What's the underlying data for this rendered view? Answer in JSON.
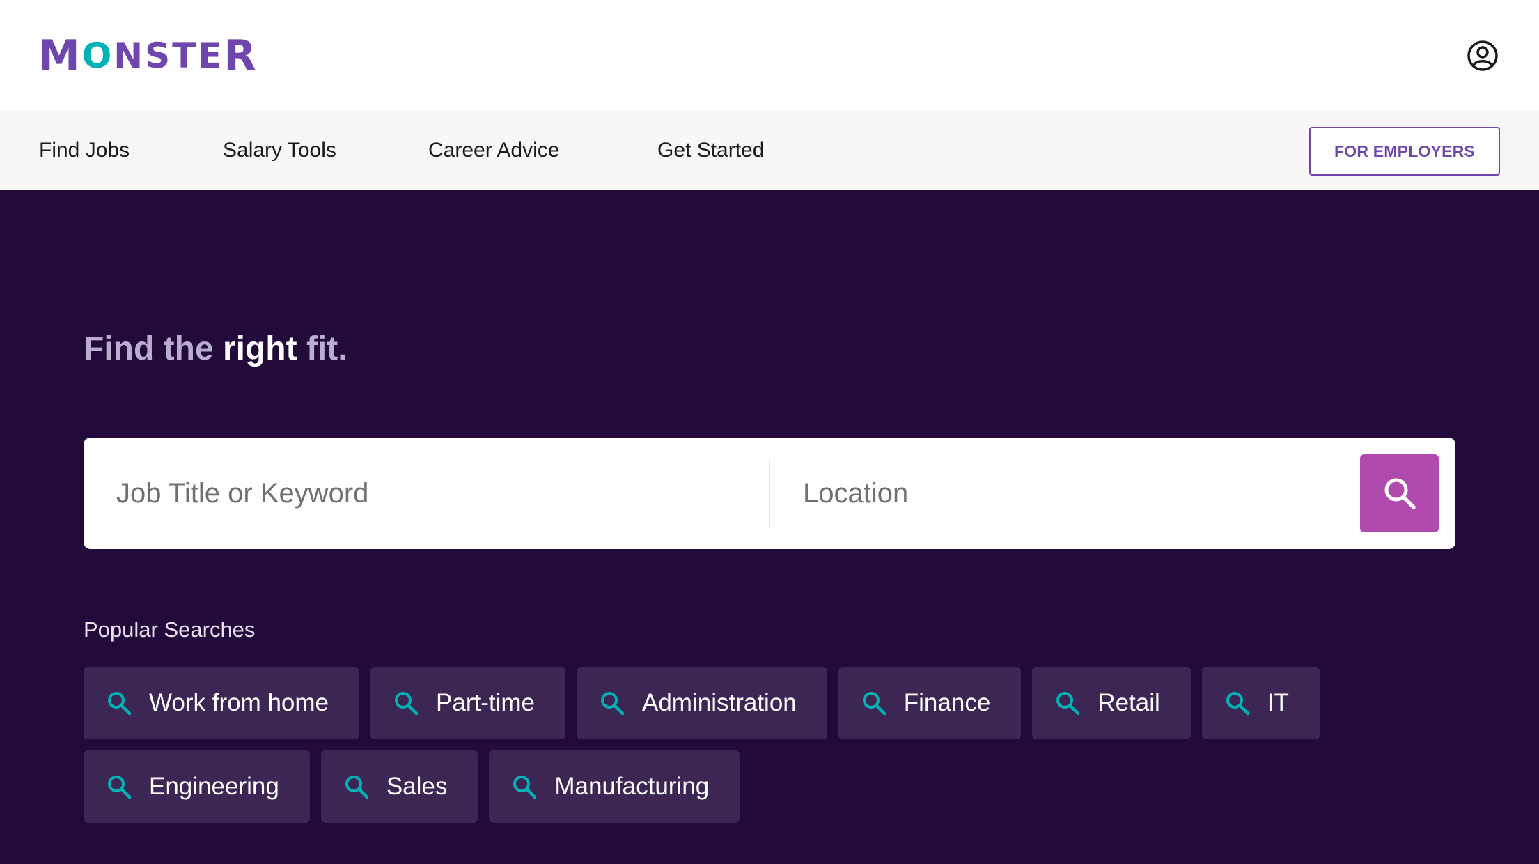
{
  "header": {
    "logo_text": "MONSTER",
    "account_icon": "user-circle-icon"
  },
  "nav": {
    "items": [
      {
        "label": "Find Jobs"
      },
      {
        "label": "Salary Tools"
      },
      {
        "label": "Career Advice"
      },
      {
        "label": "Get Started"
      }
    ],
    "employers_button": "FOR EMPLOYERS"
  },
  "hero": {
    "tagline_part1": "Find the ",
    "tagline_highlight": "right",
    "tagline_part2": " fit.",
    "search": {
      "job_placeholder": "Job Title or Keyword",
      "job_value": "",
      "location_placeholder": "Location",
      "location_value": "",
      "button_icon": "search-icon"
    },
    "popular_label": "Popular Searches",
    "popular_searches": [
      {
        "label": "Work from home"
      },
      {
        "label": "Part-time"
      },
      {
        "label": "Administration"
      },
      {
        "label": "Finance"
      },
      {
        "label": "Retail"
      },
      {
        "label": "IT"
      },
      {
        "label": "Engineering"
      },
      {
        "label": "Sales"
      },
      {
        "label": "Manufacturing"
      }
    ]
  },
  "colors": {
    "brand_purple": "#6e46ae",
    "brand_teal": "#00b2b5",
    "hero_background": "#220a3b",
    "chip_background": "#3b2654",
    "search_button": "#b04aad"
  }
}
